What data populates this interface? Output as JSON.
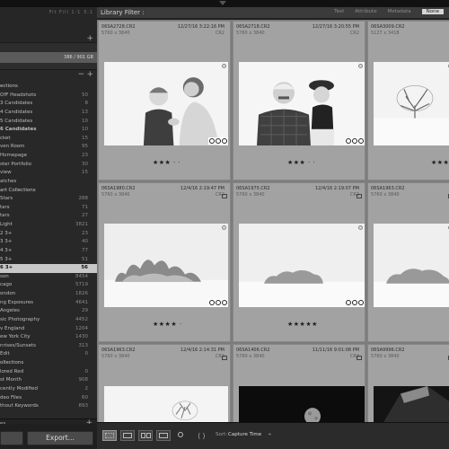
{
  "window": {
    "top_arrow": "▾"
  },
  "left_panel": {
    "top_tabs": "Fit  Fill  1:1  3:1",
    "navigator_plus": "+",
    "catalog_count": "386 / 901 GB",
    "collections_header_minus": "−",
    "collections_header_plus": "+",
    "collections": [
      {
        "label": "ections",
        "count": "",
        "header": true
      },
      {
        "label": "OfF Headshots",
        "count": "50"
      },
      {
        "label": "3 Candidates",
        "count": "8"
      },
      {
        "label": "4 Candidates",
        "count": "13"
      },
      {
        "label": "5 Candidates",
        "count": "10"
      },
      {
        "label": "6 Candidates",
        "count": "10",
        "bold": true
      },
      {
        "label": "cket",
        "count": "15"
      },
      {
        "label": "ven Room",
        "count": "95"
      },
      {
        "label": "Homepage",
        "count": "23"
      },
      {
        "label": "ster Portfolio",
        "count": "30"
      },
      {
        "label": "view",
        "count": "15"
      },
      {
        "label": "atches",
        "count": ""
      },
      {
        "label": "art Collections",
        "count": "",
        "header": true
      },
      {
        "label": "Stars",
        "count": "288"
      },
      {
        "label": "tars",
        "count": "71"
      },
      {
        "label": "tars",
        "count": "27"
      },
      {
        "label": "Light",
        "count": "3821"
      },
      {
        "label": "2 3+",
        "count": "23"
      },
      {
        "label": "3 3+",
        "count": "40"
      },
      {
        "label": "4 3+",
        "count": "77"
      },
      {
        "label": "5 3+",
        "count": "51"
      },
      {
        "label": "6 3+",
        "count": "56",
        "selected": true
      },
      {
        "label": "son",
        "count": "8454"
      },
      {
        "label": "cago",
        "count": "5719"
      },
      {
        "label": "ondon",
        "count": "1826"
      },
      {
        "label": "ng Exposures",
        "count": "4641"
      },
      {
        "label": "Angeles",
        "count": "29"
      },
      {
        "label": "sic Photography",
        "count": "4452"
      },
      {
        "label": "v England",
        "count": "1204"
      },
      {
        "label": "ew York City",
        "count": "1430"
      },
      {
        "label": "nrises/Sunsets",
        "count": "313"
      },
      {
        "label": "Edit",
        "count": "0"
      },
      {
        "label": "ollections",
        "count": "",
        "header": true
      },
      {
        "label": "lored Red",
        "count": "0"
      },
      {
        "label": "st Month",
        "count": "908"
      },
      {
        "label": "cently Modified",
        "count": "2"
      },
      {
        "label": "deo Files",
        "count": "60"
      },
      {
        "label": "thout Keywords",
        "count": "893"
      }
    ],
    "bottom_section": "es",
    "bottom_plus": "+",
    "export_label": "Export..."
  },
  "filter_bar": {
    "title": "Library Filter :",
    "options": [
      "Text",
      "Attribute",
      "Metadata",
      "None"
    ],
    "active": "None"
  },
  "grid": {
    "cells": [
      {
        "file": "06SA2728.CR2",
        "dims": "5760 x 3840",
        "date": "12/27/16 3:22:16 PM",
        "ext": "CR2",
        "stars": "★★★ · ·",
        "thumb": "family1"
      },
      {
        "file": "06SA2718.CR2",
        "dims": "5760 x 3840",
        "date": "12/27/16 3:20:55 PM",
        "ext": "CR2",
        "stars": "★★★ · ·",
        "thumb": "family2"
      },
      {
        "file": "06SA3009.CR2",
        "dims": "5127 x 3418",
        "date": "",
        "ext": "",
        "stars": "★★★",
        "thumb": "tree"
      },
      {
        "file": "06SA1980.CR2",
        "dims": "5760 x 3840",
        "date": "12/4/16 2:19:47 PM",
        "ext": "CR2",
        "stars": "★★★★ ·",
        "thumb": "snow1"
      },
      {
        "file": "06SA1975.CR2",
        "dims": "5760 x 3840",
        "date": "12/4/16 2:19:07 PM",
        "ext": "CR2",
        "stars": "★★★★★",
        "thumb": "snow2"
      },
      {
        "file": "06SA1963.CR2",
        "dims": "5760 x 3840",
        "date": "",
        "ext": "",
        "stars": "",
        "thumb": "snow3"
      },
      {
        "file": "06SA1963.CR2",
        "dims": "5760 x 3840",
        "date": "12/4/16 2:14:31 PM",
        "ext": "CR2",
        "stars": "",
        "thumb": "snow4"
      },
      {
        "file": "06SA1406.CR2",
        "dims": "5760 x 3840",
        "date": "11/11/16 9:01:08 PM",
        "ext": "CR2",
        "stars": "",
        "thumb": "moon"
      },
      {
        "file": "06SA9996.CR2",
        "dims": "5760 x 3840",
        "date": "",
        "ext": "",
        "stars": "",
        "thumb": "dark"
      }
    ]
  },
  "toolbar": {
    "sort_label": "Sort:",
    "sort_value": "Capture Time",
    "sort_caret": "÷"
  }
}
